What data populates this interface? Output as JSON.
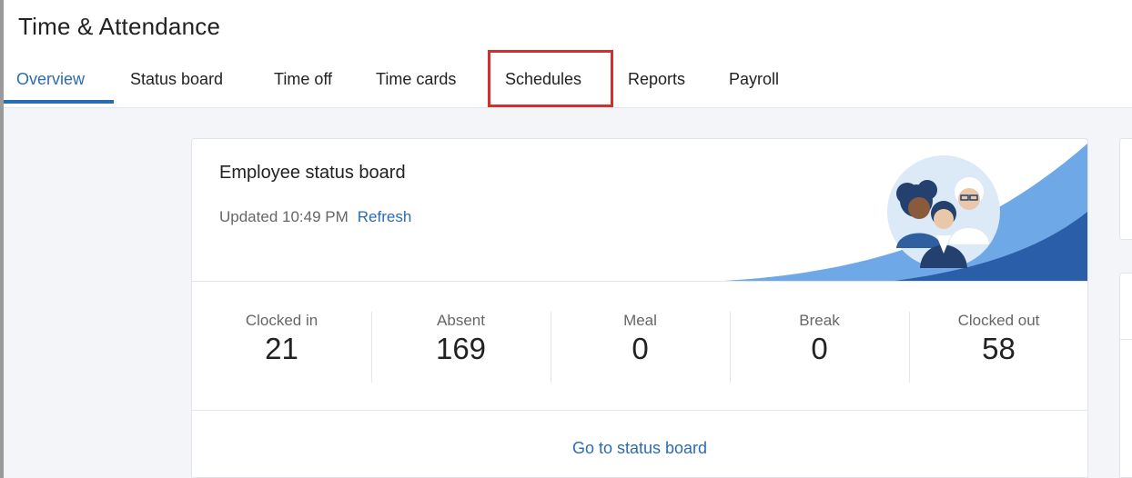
{
  "header": {
    "title": "Time & Attendance",
    "tabs": [
      {
        "label": "Overview",
        "active": true
      },
      {
        "label": "Status board"
      },
      {
        "label": "Time off"
      },
      {
        "label": "Time cards"
      },
      {
        "label": "Schedules",
        "highlighted": true
      },
      {
        "label": "Reports"
      },
      {
        "label": "Payroll"
      }
    ]
  },
  "status_card": {
    "title": "Employee status board",
    "updated_text": "Updated 10:49 PM",
    "refresh_label": "Refresh",
    "stats": [
      {
        "label": "Clocked in",
        "value": "21"
      },
      {
        "label": "Absent",
        "value": "169"
      },
      {
        "label": "Meal",
        "value": "0"
      },
      {
        "label": "Break",
        "value": "0"
      },
      {
        "label": "Clocked out",
        "value": "58"
      }
    ],
    "footer_link": "Go to status board",
    "illustration_icon": "employees-group-icon"
  },
  "colors": {
    "accent": "#2b6cb0",
    "highlight": "#d32f2f",
    "wave_light": "#6fa8e6",
    "wave_dark": "#2a5ea8"
  }
}
